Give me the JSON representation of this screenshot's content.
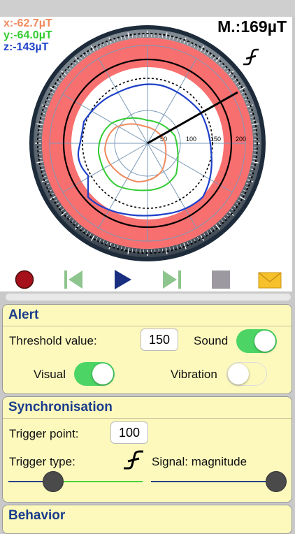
{
  "scope": {
    "x_reading": "x:-62.7µT",
    "y_reading": "y:-64.0µT",
    "z_reading": "z:-143µT",
    "magnitude": "M.:169µT",
    "radial_ticks": [
      "50",
      "100",
      "150",
      "200"
    ],
    "colors": {
      "x": "#f08a5d",
      "y": "#33cc33",
      "z": "#1e40c8",
      "alert_band": "#f86f6f"
    }
  },
  "toolbar": {
    "record": "record-icon",
    "previous": "skip-back-icon",
    "play": "play-icon",
    "next": "skip-forward-icon",
    "stop": "stop-icon",
    "email": "envelope-icon"
  },
  "alert": {
    "title": "Alert",
    "threshold_label": "Threshold value:",
    "threshold_value": "150",
    "sound_label": "Sound",
    "sound_on": true,
    "visual_label": "Visual",
    "visual_on": true,
    "vibration_label": "Vibration",
    "vibration_on": false
  },
  "sync": {
    "title": "Synchronisation",
    "trigger_point_label": "Trigger point:",
    "trigger_point_value": "100",
    "trigger_type_label": "Trigger type:",
    "trigger_type_icon": "rising-edge-icon",
    "signal_label": "Signal: magnitude",
    "slider_left_fraction": 0.3,
    "slider_right_fraction": 1.0
  },
  "behavior": {
    "title": "Behavior"
  }
}
